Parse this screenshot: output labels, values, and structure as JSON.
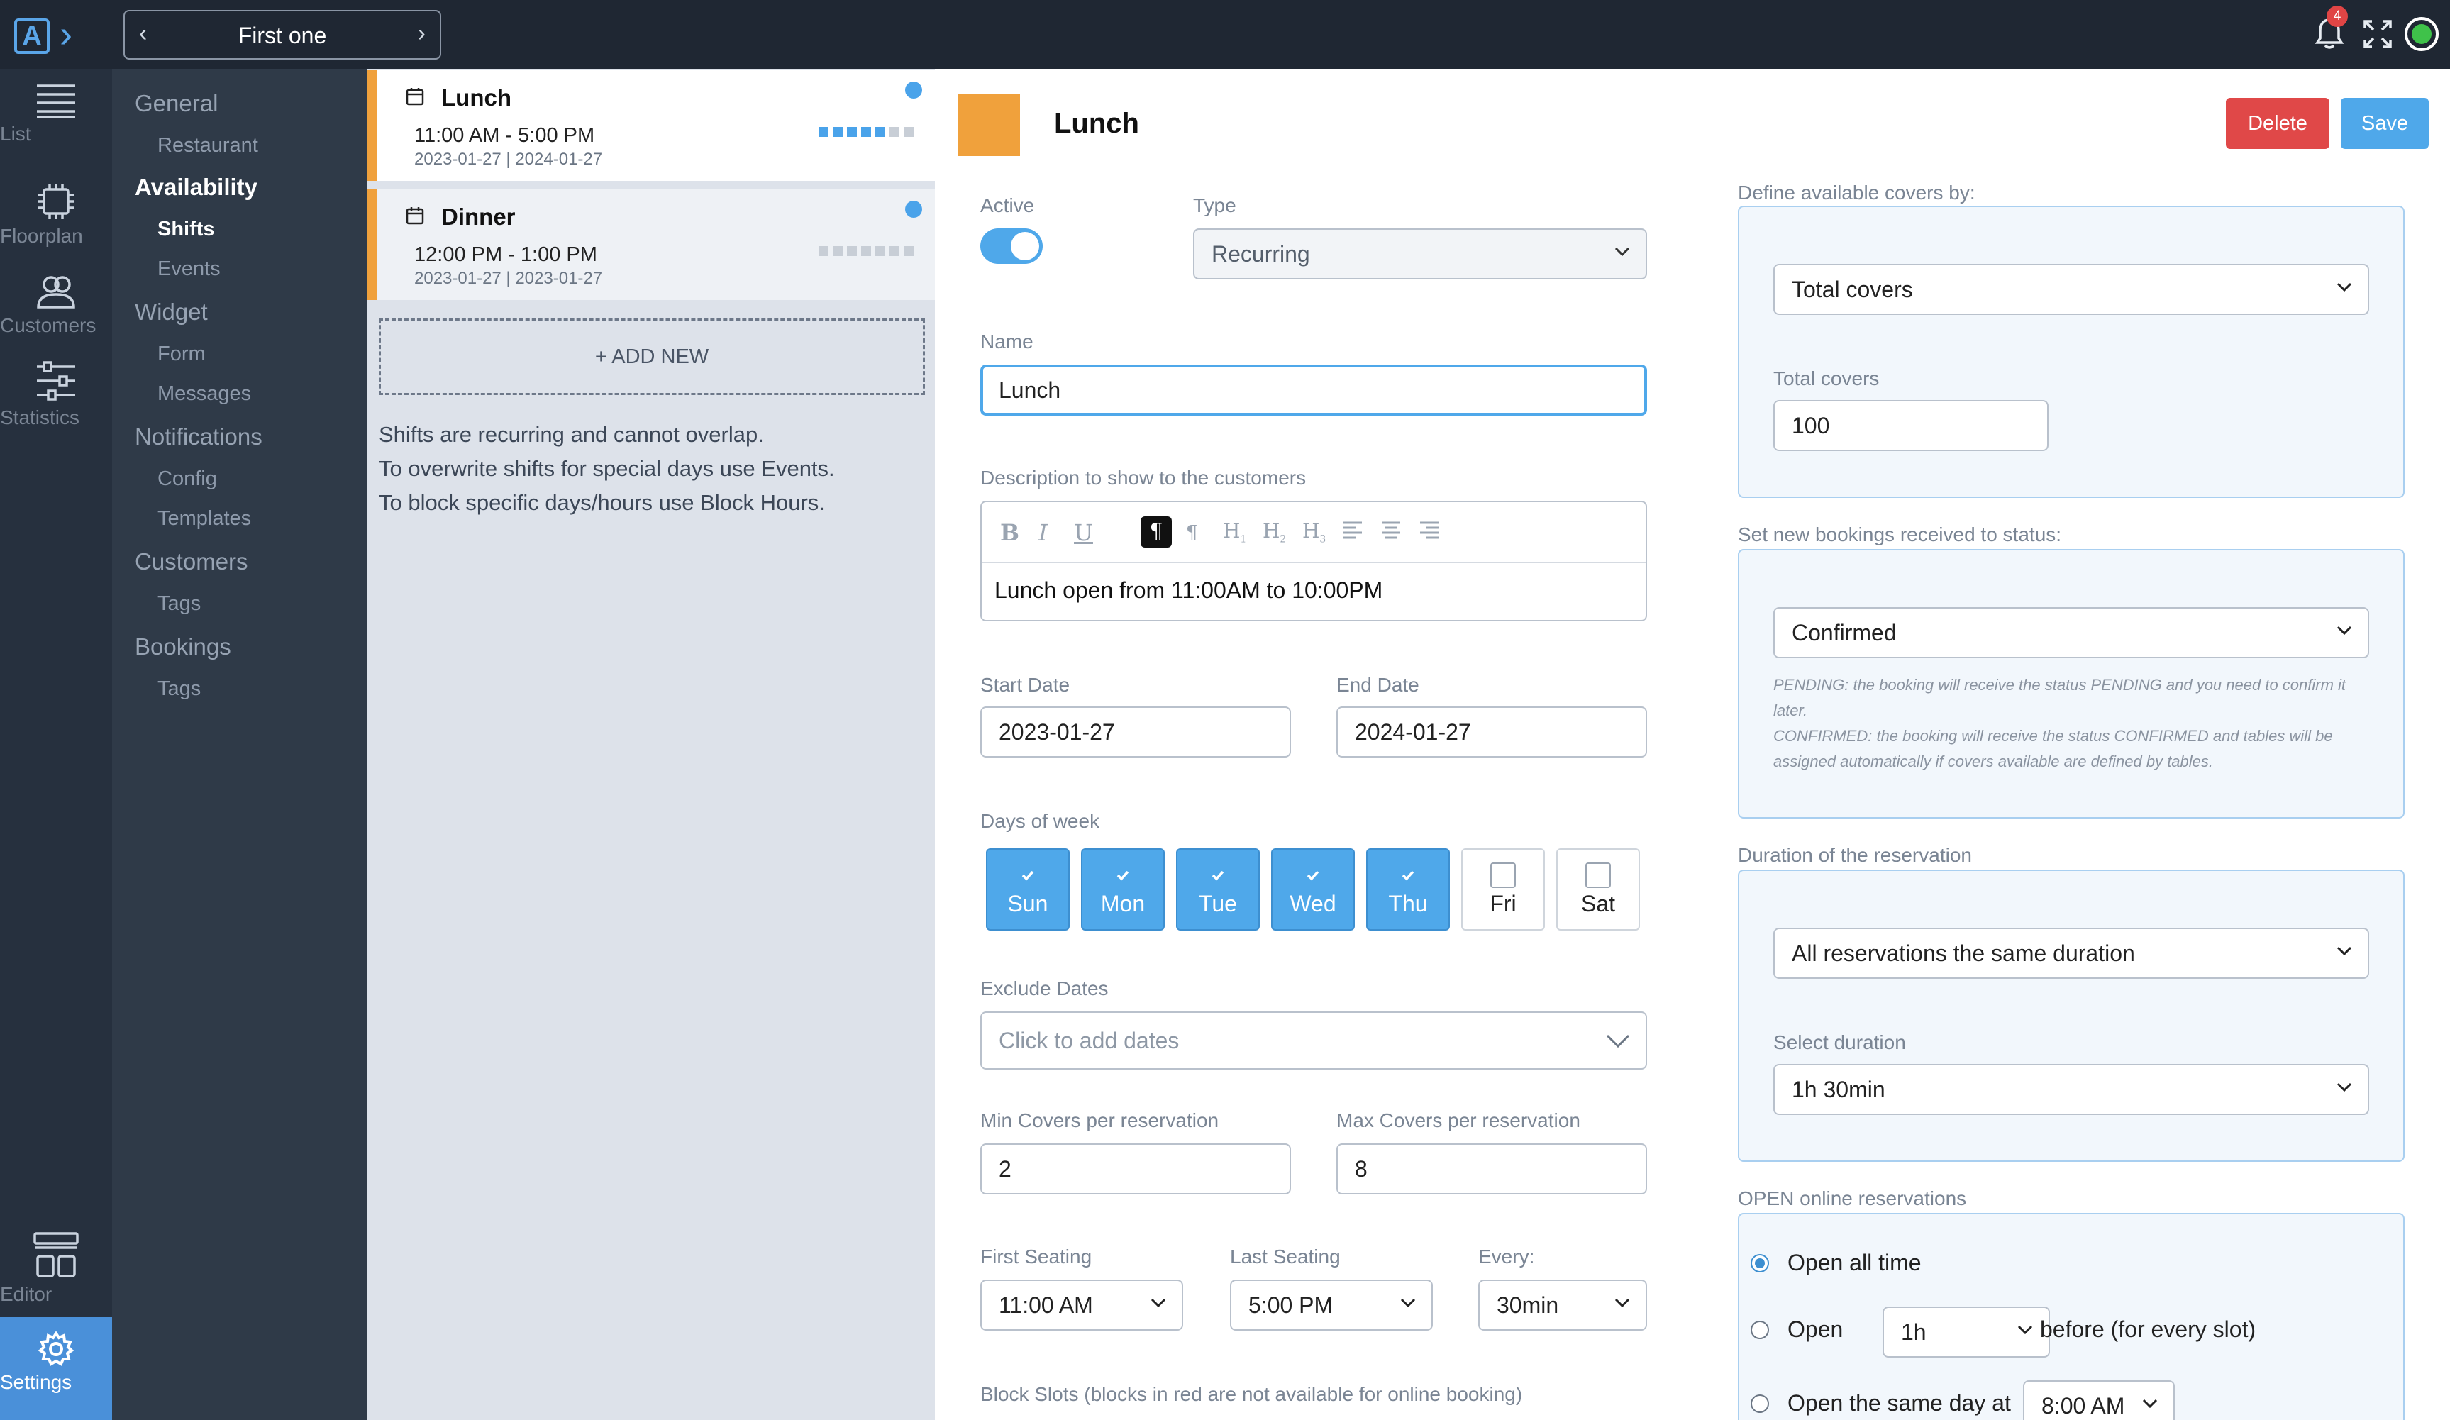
{
  "topbar": {
    "venue": "First one",
    "notifications": "4",
    "logo": "A"
  },
  "rail": {
    "list": "List",
    "floorplan": "Floorplan",
    "customers": "Customers",
    "statistics": "Statistics",
    "editor": "Editor",
    "settings": "Settings"
  },
  "menu": {
    "general": "General",
    "restaurant": "Restaurant",
    "availability": "Availability",
    "shifts": "Shifts",
    "events": "Events",
    "widget": "Widget",
    "form": "Form",
    "messages": "Messages",
    "notifications": "Notifications",
    "config": "Config",
    "templates": "Templates",
    "customers": "Customers",
    "customer_tags": "Tags",
    "bookings": "Bookings",
    "booking_tags": "Tags"
  },
  "shifts": [
    {
      "name": "Lunch",
      "time": "11:00 AM - 5:00 PM",
      "dates": "2023-01-27 | 2024-01-27"
    },
    {
      "name": "Dinner",
      "time": "12:00 PM - 1:00 PM",
      "dates": "2023-01-27 | 2023-01-27"
    }
  ],
  "add_new": "+ ADD NEW",
  "help": [
    "Shifts are recurring and cannot overlap.",
    "To overwrite shifts for special days use Events.",
    "To block specific days/hours use Block Hours."
  ],
  "form": {
    "title": "Lunch",
    "delete": "Delete",
    "save": "Save",
    "active_label": "Active",
    "active": true,
    "type_label": "Type",
    "type": "Recurring",
    "name_label": "Name",
    "name": "Lunch",
    "desc_label": "Description to show to the customers",
    "desc": "Lunch open from 11:00AM to 10:00PM",
    "start_label": "Start Date",
    "start": "2023-01-27",
    "end_label": "End Date",
    "end": "2024-01-27",
    "days_label": "Days of week",
    "days": [
      {
        "name": "Sun",
        "checked": true
      },
      {
        "name": "Mon",
        "checked": true
      },
      {
        "name": "Tue",
        "checked": true
      },
      {
        "name": "Wed",
        "checked": true
      },
      {
        "name": "Thu",
        "checked": true
      },
      {
        "name": "Fri",
        "checked": false
      },
      {
        "name": "Sat",
        "checked": false
      }
    ],
    "exclude_label": "Exclude Dates",
    "exclude_placeholder": "Click to add dates",
    "min_label": "Min Covers per reservation",
    "min": "2",
    "max_label": "Max Covers per reservation",
    "max": "8",
    "first_label": "First Seating",
    "first": "11:00 AM",
    "last_label": "Last Seating",
    "last": "5:00 PM",
    "every_label": "Every:",
    "every": "30min",
    "block_label": "Block Slots (blocks in red are not available for online booking)"
  },
  "right": {
    "covers_label": "Define available covers by:",
    "covers_mode": "Total covers",
    "total_label": "Total covers",
    "total": "100",
    "status_label": "Set new bookings received to status:",
    "status": "Confirmed",
    "hint1": "PENDING: the booking will receive the status PENDING and you need to confirm it later.",
    "hint2": "CONFIRMED: the booking will receive the status CONFIRMED and tables will be assigned automatically if covers available are defined by tables.",
    "duration_label": "Duration of the reservation",
    "duration_mode": "All reservations the same duration",
    "select_duration_label": "Select duration",
    "duration": "1h 30min",
    "open_label": "OPEN online reservations",
    "open_all": "Open all time",
    "open": "Open",
    "open_before_value": "1h",
    "open_before_suffix": "before (for every slot)",
    "open_same_day": "Open the same day at",
    "open_same_day_value": "8:00 AM",
    "open_mode": "all"
  },
  "colors": {
    "accent": "#4fa8ea",
    "shift": "#f0a13c",
    "danger": "#e04848",
    "topbar": "#1f2733"
  }
}
